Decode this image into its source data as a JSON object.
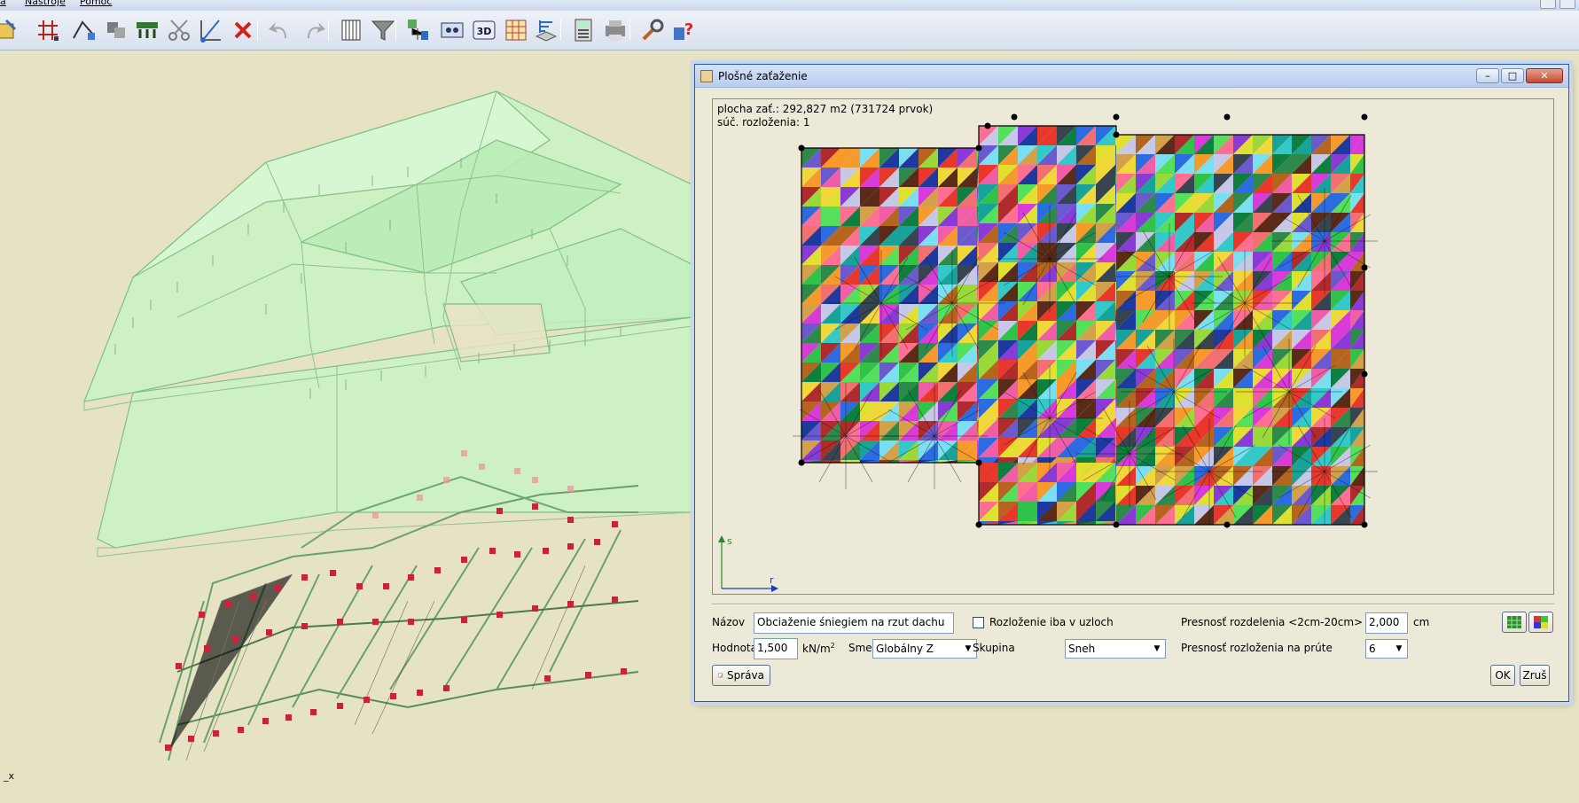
{
  "menubar": {
    "items": [
      "a",
      "Nástroje",
      "Pomoc"
    ]
  },
  "toolbar": {
    "icons": [
      "import-icon",
      "frame-icon",
      "node-add-icon",
      "copy-elements-icon",
      "loads-icon",
      "scissors-icon",
      "dimension-icon",
      "delete-icon",
      "undo-icon",
      "redo-icon",
      "grid-icon",
      "filter-icon",
      "network-icon",
      "view-icon",
      "3d-icon",
      "table-icon",
      "layers-icon",
      "calculator-icon",
      "print-icon",
      "tools-icon",
      "help-icon"
    ]
  },
  "viewport": {
    "axis_label": "_x"
  },
  "dialog": {
    "title": "Plošné zaťaženie",
    "window_controls": {
      "minimize": "–",
      "maximize": "□",
      "close": "✕"
    },
    "info": {
      "line1": "plocha zať.: 292,827 m2 (731724 prvok)",
      "line2": "súč. rozloženia: 1"
    },
    "axes": {
      "s": "s",
      "r": "r"
    },
    "form": {
      "name_label": "Názov",
      "name_value": "Obciaženie śniegiem na rzut dachu",
      "value_label": "Hodnota",
      "value_value": "1,500",
      "unit": "kN/m",
      "unit_exp": "2",
      "direction_label": "Smer",
      "direction_value": "Globálny Z",
      "only_nodes_label": "Rozloženie iba v uzloch",
      "group_label": "Skupina",
      "group_value": "Sneh",
      "precision_label": "Presnosť rozdelenia <2cm-20cm>",
      "precision_value": "2,000",
      "precision_unit": "cm",
      "bar_precision_label": "Presnosť rozloženia na prúte",
      "bar_precision_value": "6"
    },
    "buttons": {
      "manage": "Správa",
      "ok": "OK",
      "cancel": "Zruš"
    },
    "colors": {
      "accent": "#2a5aa6",
      "background": "#ece9d8"
    }
  }
}
